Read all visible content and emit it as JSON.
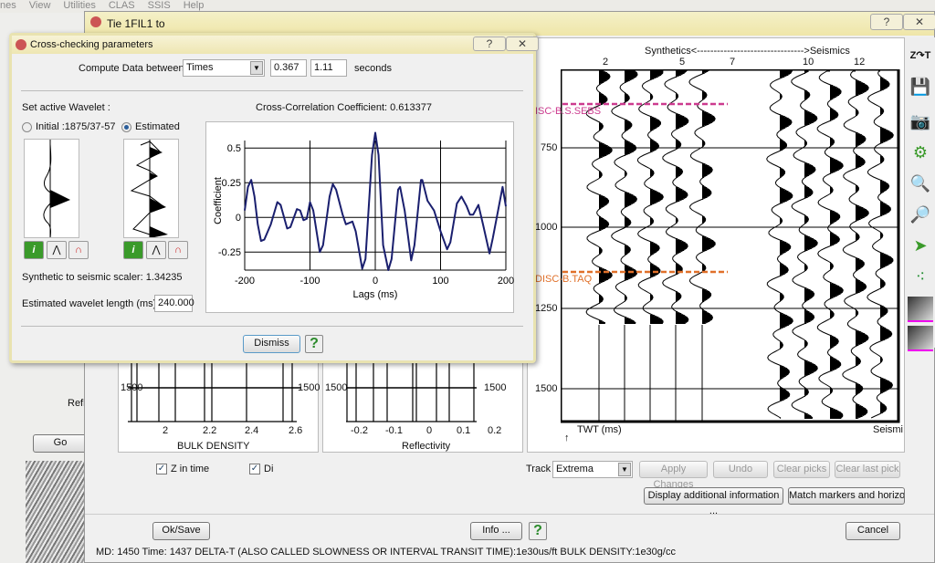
{
  "bg_app": {
    "menu": [
      "nes",
      "View",
      "Utilities",
      "CLAS",
      "SSIS",
      "Help"
    ],
    "refl_label": "Refl",
    "go_label": "Go"
  },
  "window": {
    "title": "Tie 1FIL1 to",
    "help": "?",
    "close": "✕"
  },
  "density_panel": {
    "depth_label_left": "1500",
    "depth_label_right": "1500",
    "ticks": [
      "2",
      "2.2",
      "2.4",
      "2.6"
    ],
    "xlabel": "BULK DENSITY"
  },
  "reflectivity_panel": {
    "depth_label_left": "1500",
    "depth_label_right": "1500",
    "ticks": [
      "-0.2",
      "-0.1",
      "0",
      "0.1",
      "0.2"
    ],
    "xlabel": "Reflectivity"
  },
  "seismic_panel": {
    "header": "Synthetics<-------------------------------->Seismics",
    "trace_labels": [
      "2",
      "5",
      "7",
      "10",
      "12"
    ],
    "depth_ticks": [
      "750",
      "1000",
      "1250",
      "1500"
    ],
    "ylabel": "TWT (ms)",
    "footer": "Seismi",
    "markers": [
      {
        "name": "DISC-B.S.SEBS",
        "color": "#cc3b8f"
      },
      {
        "name": "DISC-B.TAQ",
        "color": "#e0702a"
      }
    ]
  },
  "toolbar": {
    "icons": [
      "z-t-conversion-icon",
      "save-icon",
      "camera-icon",
      "settings-gear-icon",
      "zoom-in-icon",
      "zoom-out-icon",
      "pointer-icon",
      "points-icon",
      "pick-horizon-icon",
      "horizon-icon"
    ]
  },
  "options": {
    "z_in_time": "Z in time",
    "z_in_time_checked": true,
    "di": "Di",
    "di_checked": true
  },
  "track": {
    "label": "Track",
    "value": "Extrema",
    "apply": "Apply Changes",
    "undo": "Undo",
    "clear_picks": "Clear picks",
    "clear_last": "Clear last pick",
    "display_info": "Display additional information ...",
    "match": "Match markers and horizon"
  },
  "footer": {
    "ok": "Ok/Save",
    "info": "Info ...",
    "help": "?",
    "cancel": "Cancel",
    "status": "MD: 1450 Time: 1437  DELTA-T (ALSO CALLED SLOWNESS OR INTERVAL TRANSIT TIME):1e30us/ft  BULK DENSITY:1e30g/cc"
  },
  "dialog": {
    "title": "Cross-checking parameters",
    "help": "?",
    "close": "✕",
    "compute_label": "Compute Data between",
    "compute_mode": "Times",
    "start": "0.367",
    "end": "1.11",
    "unit": "seconds",
    "wavelet_label": "Set active Wavelet :",
    "initial": "Initial :1875/37-57",
    "estimated": "Estimated",
    "selected": "Estimated",
    "scaler": "Synthetic to seismic scaler: 1.34235",
    "length_label": "Estimated wavelet length (ms)",
    "length": "240.000",
    "dismiss": "Dismiss",
    "help2": "?"
  },
  "chart_data": {
    "type": "line",
    "title": "Cross-Correlation Coefficient: 0.613377",
    "xlabel": "Lags (ms)",
    "ylabel": "Coefficient",
    "xlim": [
      -200,
      200
    ],
    "ylim": [
      -0.38,
      0.62
    ],
    "xticks": [
      "-200",
      "-100",
      "0",
      "100",
      "200"
    ],
    "yticks": [
      "0.5",
      "0.25",
      "0",
      "-0.25"
    ],
    "grid": true,
    "color": "#1a1f6e",
    "x": [
      -200,
      -195,
      -190,
      -185,
      -180,
      -175,
      -170,
      -160,
      -150,
      -145,
      -135,
      -130,
      -120,
      -115,
      -110,
      -105,
      -100,
      -95,
      -85,
      -80,
      -70,
      -65,
      -60,
      -50,
      -45,
      -35,
      -30,
      -20,
      -15,
      -5,
      0,
      5,
      12,
      20,
      25,
      35,
      38,
      45,
      55,
      60,
      70,
      72,
      80,
      90,
      100,
      110,
      115,
      125,
      132,
      140,
      145,
      150,
      158,
      165,
      175,
      180,
      195,
      200
    ],
    "y": [
      0.05,
      0.22,
      0.27,
      0.15,
      -0.05,
      -0.17,
      -0.16,
      -0.05,
      0.11,
      0.09,
      -0.08,
      -0.07,
      0.06,
      0.05,
      -0.02,
      -0.01,
      0.11,
      0.05,
      -0.25,
      -0.2,
      0.15,
      0.24,
      0.2,
      0.02,
      -0.05,
      -0.03,
      -0.1,
      -0.37,
      -0.3,
      0.45,
      0.61,
      0.45,
      -0.2,
      -0.38,
      -0.3,
      0.2,
      0.22,
      0.05,
      -0.31,
      -0.2,
      0.27,
      0.27,
      0.12,
      0.05,
      -0.1,
      -0.23,
      -0.18,
      0.1,
      0.15,
      0.08,
      0.02,
      0.02,
      0.09,
      -0.05,
      -0.26,
      -0.15,
      0.22,
      0.08
    ]
  }
}
